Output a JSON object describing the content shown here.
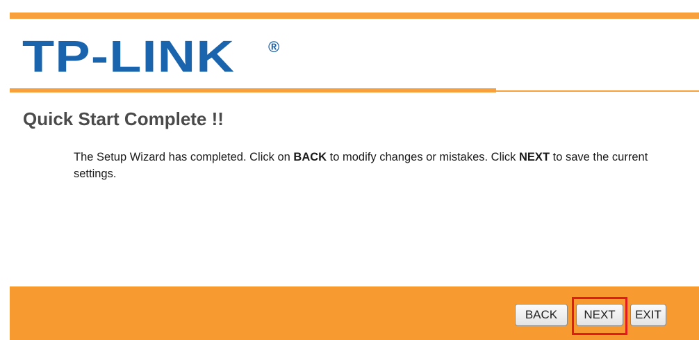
{
  "header": {
    "logo_text": "TP-LINK",
    "logo_registered": "®"
  },
  "page": {
    "title": "Quick Start Complete !!"
  },
  "message": {
    "part1": "The Setup Wizard has completed. Click on ",
    "back_word": "BACK",
    "part2": " to modify changes or mistakes. Click ",
    "next_word": "NEXT",
    "part3": " to save the current settings."
  },
  "buttons": {
    "back_label": "BACK",
    "next_label": "NEXT",
    "exit_label": "EXIT"
  },
  "colors": {
    "brand_blue": "#1a63ad",
    "accent_orange": "#f79a30",
    "highlight_red": "#e01b1b"
  }
}
